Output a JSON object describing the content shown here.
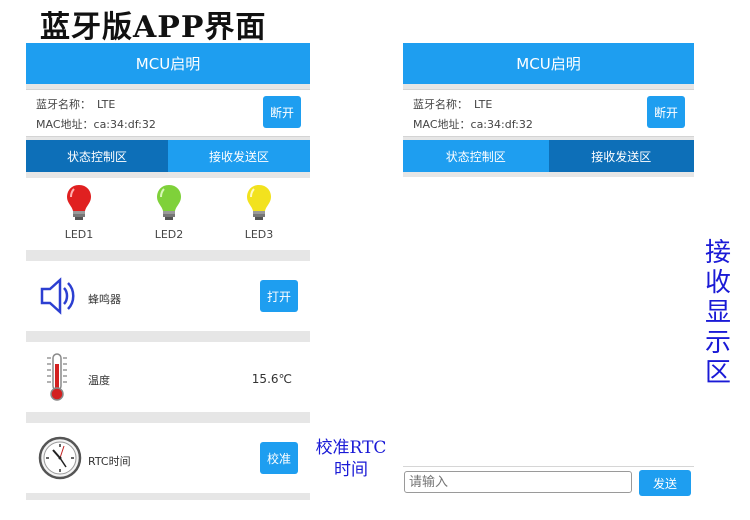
{
  "page_title": "蓝牙版APP界面",
  "app": {
    "title": "MCU启明",
    "bt_name_label": "蓝牙名称：",
    "bt_name_value": "LTE",
    "mac_label": "MAC地址：",
    "mac_value": "ca:34:df:32",
    "disconnect_label": "断开",
    "tabs": [
      {
        "label": "状态控制区"
      },
      {
        "label": "接收发送区"
      }
    ]
  },
  "left_screen": {
    "leds": [
      {
        "label": "LED1",
        "color": "#e02020"
      },
      {
        "label": "LED2",
        "color": "#7fd13a"
      },
      {
        "label": "LED3",
        "color": "#f2e21e"
      }
    ],
    "buzzer": {
      "label": "蜂鸣器",
      "button": "打开",
      "icon": "speaker-icon"
    },
    "temperature": {
      "label": "温度",
      "value": "15.6℃",
      "icon": "thermometer-icon"
    },
    "rtc": {
      "label": "RTC时间",
      "button": "校准",
      "icon": "clock-icon"
    }
  },
  "right_screen": {
    "input_placeholder": "请输入",
    "send_label": "发送"
  },
  "annotations": {
    "rtc_line1": "校准RTC",
    "rtc_line2": "时间",
    "recv": "接收显示区"
  },
  "colors": {
    "accent": "#1e9ef0",
    "tab_active": "#0d6fb8",
    "annotation": "#1a1ad6"
  }
}
